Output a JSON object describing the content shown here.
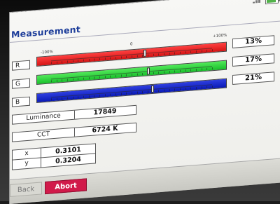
{
  "app": {
    "title": "Measurement"
  },
  "scale_labels": {
    "left": "-100%",
    "center": "0",
    "right": "+100%"
  },
  "channels": [
    {
      "label": "R",
      "percent": "13%",
      "color": "#d41414",
      "position_fraction": 0.57
    },
    {
      "label": "G",
      "percent": "17%",
      "color": "#19c02b",
      "position_fraction": 0.59
    },
    {
      "label": "B",
      "percent": "21%",
      "color": "#0a1ab5",
      "position_fraction": 0.61
    }
  ],
  "readings": {
    "luminance": {
      "label": "Luminance",
      "value": "17849"
    },
    "cct": {
      "label": "CCT",
      "value": "6724 K"
    },
    "x": {
      "label": "x",
      "value": "0.3101"
    },
    "y": {
      "label": "y",
      "value": "0.3204"
    }
  },
  "footer": {
    "back_label": "Back",
    "abort_label": "Abort",
    "abort_color": "#d11a4a"
  },
  "status": {
    "battery_icon": "battery-icon",
    "signal_icon": "signal-icon"
  }
}
